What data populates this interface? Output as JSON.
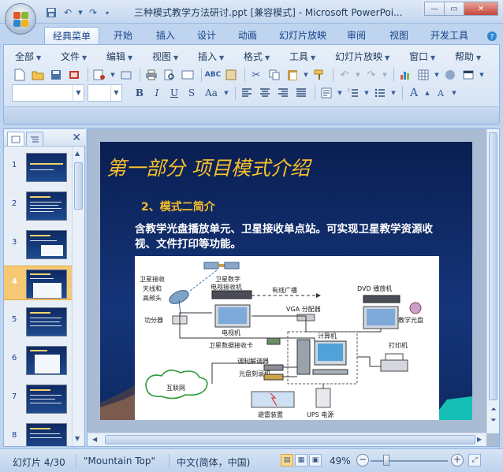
{
  "window": {
    "title": "三种模式教学方法研讨.ppt [兼容模式] - Microsoft PowerPoi...",
    "minimize": "—",
    "maximize": "▭",
    "close": "✕"
  },
  "quick_access": [
    "save-icon",
    "undo-icon",
    "redo-icon",
    "customize-icon"
  ],
  "tabs": [
    {
      "label": "经典菜单",
      "active": true
    },
    {
      "label": "开始"
    },
    {
      "label": "插入"
    },
    {
      "label": "设计"
    },
    {
      "label": "动画"
    },
    {
      "label": "幻灯片放映"
    },
    {
      "label": "审阅"
    },
    {
      "label": "视图"
    },
    {
      "label": "开发工具"
    }
  ],
  "menus": [
    "全部",
    "文件",
    "编辑",
    "视图",
    "插入",
    "格式",
    "工具",
    "幻灯片放映",
    "窗口",
    "帮助"
  ],
  "format_buttons": {
    "bold": "B",
    "italic": "I",
    "underline": "U",
    "strike": "S",
    "case": "Aa"
  },
  "slides_panel": {
    "slide_numbers": [
      "1",
      "2",
      "3",
      "4",
      "5",
      "6",
      "7",
      "8"
    ],
    "selected": "4"
  },
  "slide": {
    "title": "第一部分  项目模式介绍",
    "subtitle": "2、模式二简介",
    "body": "含教学光盘播放单元、卫星接收单点站。可实现卫星教学资源收视、文件打印等功能。",
    "diagram_labels": {
      "sat_dish": "卫星接收",
      "dish_line": "天线和",
      "lnb": "高频头",
      "sat_receiver_1": "卫星数字",
      "sat_receiver_2": "电视接收机",
      "cable": "有线广播",
      "dvd": "DVD 播放机",
      "vga": "VGA 分配器",
      "amplifier": "功分器",
      "tv": "电视机",
      "disc": "教学光盘",
      "sat_card": "卫星数据接收卡",
      "computer": "计算机",
      "modem": "调制解调器",
      "burner": "光盘刻录机",
      "printer": "打印机",
      "internet": "互联网",
      "lightning": "避雷装置",
      "ups": "UPS 电源"
    }
  },
  "statusbar": {
    "slide_info": "幻灯片 4/30",
    "theme": "\"Mountain Top\"",
    "language": "中文(简体，中国)",
    "zoom": "49%"
  }
}
